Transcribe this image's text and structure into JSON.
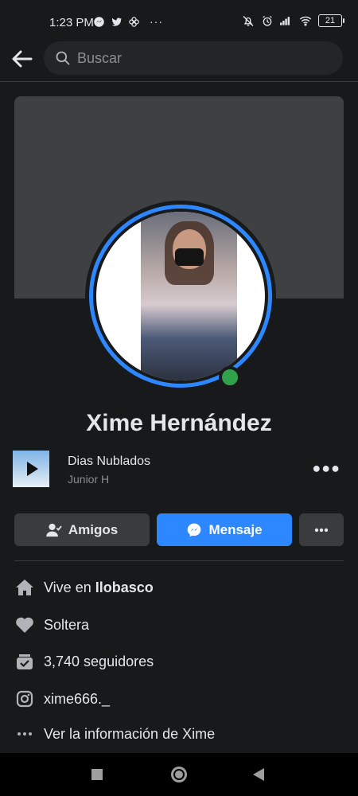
{
  "status_bar": {
    "time": "1:23 PM",
    "dots": "···",
    "battery": "21"
  },
  "search": {
    "placeholder": "Buscar"
  },
  "profile": {
    "name": "Xime Hernández",
    "online": true
  },
  "song": {
    "title": "Dias Nublados",
    "artist": "Junior H"
  },
  "actions": {
    "friends_label": "Amigos",
    "message_label": "Mensaje"
  },
  "info": {
    "lives_prefix": "Vive en ",
    "lives_place": "Ilobasco",
    "relationship": "Soltera",
    "followers": "3,740 seguidores",
    "instagram": "xime666._",
    "see_info": "Ver la información de Xime"
  },
  "colors": {
    "background": "#18191a",
    "accent": "#2d88ff",
    "online": "#31a24c",
    "button_gray": "#3a3b3c"
  }
}
